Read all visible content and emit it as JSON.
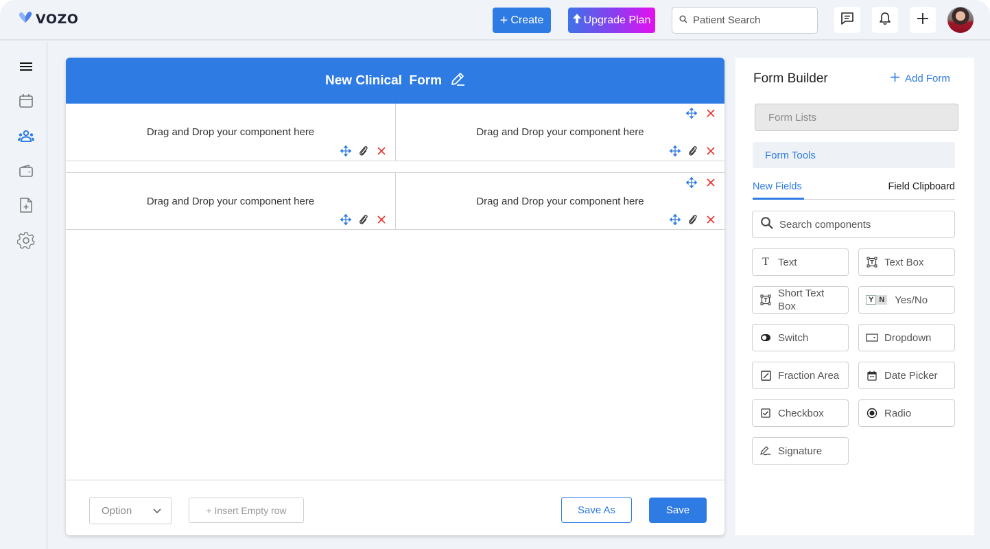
{
  "app": {
    "logo_text": "VOZO",
    "brand_color": "#2e7be4"
  },
  "topbar": {
    "create_label": "Create",
    "upgrade_label": "Upgrade Plan",
    "search_placeholder": "Patient Search",
    "icons": [
      "chat-icon",
      "bell-icon",
      "plus-icon",
      "avatar"
    ]
  },
  "leftnav": {
    "items": [
      {
        "name": "menu",
        "icon": "hamburger-icon",
        "active": false
      },
      {
        "name": "calendar",
        "icon": "calendar-icon",
        "active": false
      },
      {
        "name": "patients",
        "icon": "users-icon",
        "active": true
      },
      {
        "name": "billing",
        "icon": "wallet-icon",
        "active": false
      },
      {
        "name": "documents",
        "icon": "file-plus-icon",
        "active": false
      },
      {
        "name": "settings",
        "icon": "gear-icon",
        "active": false
      }
    ]
  },
  "form": {
    "title": "New Clinical  Form",
    "rows": [
      {
        "cells": [
          {
            "placeholder": "Drag and Drop your component here"
          },
          {
            "placeholder": "Drag and Drop your component here"
          }
        ]
      },
      {
        "cells": [
          {
            "placeholder": "Drag and Drop your component here"
          },
          {
            "placeholder": "Drag and Drop your component here"
          }
        ]
      }
    ],
    "footer": {
      "option_label": "Option",
      "insert_row_label": "+ Insert Empty row",
      "save_as_label": "Save As",
      "save_label": "Save"
    }
  },
  "builder": {
    "title": "Form Builder",
    "add_form_label": "Add Form",
    "form_lists_label": "Form Lists",
    "form_tools_label": "Form Tools",
    "tabs": [
      {
        "label": "New Fields",
        "active": true
      },
      {
        "label": "Field Clipboard",
        "active": false
      }
    ],
    "search_placeholder": "Search components",
    "components": [
      {
        "label": "Text",
        "icon": "text-icon"
      },
      {
        "label": "Text Box",
        "icon": "textbox-icon"
      },
      {
        "label": "Short Text Box",
        "icon": "short-textbox-icon"
      },
      {
        "label": "Yes/No",
        "icon": "yes-no-icon",
        "icon_text": [
          "Y",
          "N"
        ]
      },
      {
        "label": "Switch",
        "icon": "switch-icon"
      },
      {
        "label": "Dropdown",
        "icon": "dropdown-icon"
      },
      {
        "label": "Fraction Area",
        "icon": "fraction-icon"
      },
      {
        "label": "Date Picker",
        "icon": "calendar-icon"
      },
      {
        "label": "Checkbox",
        "icon": "checkbox-icon"
      },
      {
        "label": "Radio",
        "icon": "radio-icon"
      },
      {
        "label": "Signature",
        "icon": "signature-icon"
      }
    ]
  }
}
